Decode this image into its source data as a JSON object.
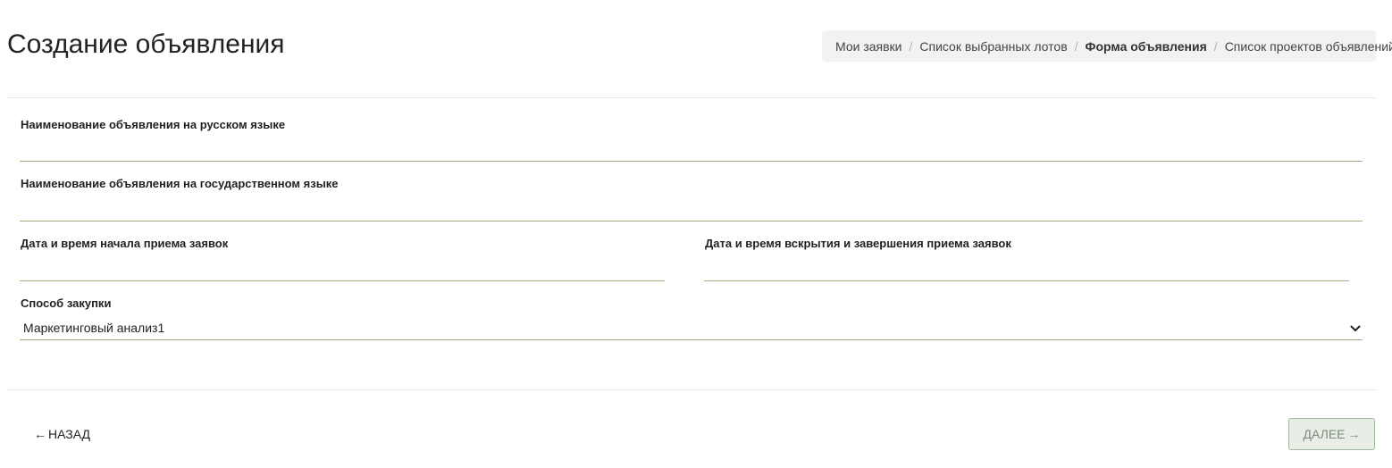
{
  "page": {
    "title": "Создание объявления"
  },
  "breadcrumb": {
    "items": [
      {
        "label": "Мои заявки",
        "active": false
      },
      {
        "label": "Список выбранных лотов",
        "active": false
      },
      {
        "label": "Форма объявления",
        "active": true
      },
      {
        "label": "Список проектов объявлений",
        "active": false
      }
    ],
    "separator": "/"
  },
  "form": {
    "name_ru": {
      "label": "Наименование объявления на русском языке",
      "value": ""
    },
    "name_state": {
      "label": "Наименование объявления на государственном языке",
      "value": ""
    },
    "start_datetime": {
      "label": "Дата и время начала приема заявок",
      "value": ""
    },
    "end_datetime": {
      "label": "Дата и время вскрытия и завершения приема заявок",
      "value": ""
    },
    "procurement_method": {
      "label": "Способ закупки",
      "selected": "Маркетинговый анализ1",
      "icon": "chevron-down-icon"
    }
  },
  "footer": {
    "back": {
      "arrow": "←",
      "label": "НАЗАД"
    },
    "next": {
      "label": "ДАЛЕЕ",
      "arrow": "→",
      "disabled": true
    }
  },
  "colors": {
    "field_underline": "#a9a97f",
    "breadcrumb_bg": "#f2f2f2",
    "next_bg": "#e8eee6",
    "next_border": "#9fb79f"
  }
}
